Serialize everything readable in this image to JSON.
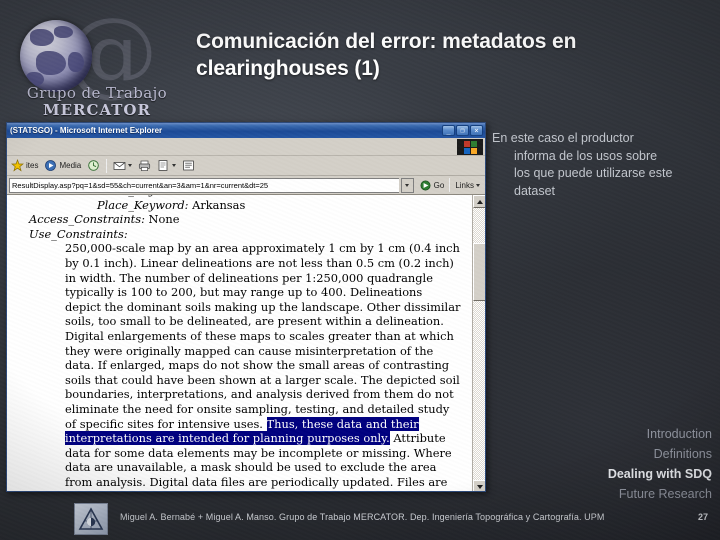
{
  "logo": {
    "at_symbol": "@",
    "line1": "Grupo de Trabajo",
    "line2": "MERCATOR"
  },
  "slide": {
    "title": "Comunicación del error: metadatos en clearinghouses (1)",
    "number": "27",
    "footer": "Miguel A. Bernabé + Miguel A. Manso. Grupo de Trabajo MERCATOR. Dep. Ingeniería Topográfica y Cartografía. UPM"
  },
  "annotation": {
    "line1": "En este caso el productor",
    "line2": "informa de los usos sobre",
    "line3": "los que puede utilizarse este",
    "line4": "dataset"
  },
  "nav": {
    "items": [
      {
        "label": "Introduction",
        "active": false
      },
      {
        "label": "Definitions",
        "active": false
      },
      {
        "label": "Dealing with SDQ",
        "active": true
      },
      {
        "label": "Future Research",
        "active": false
      }
    ]
  },
  "browser": {
    "title": "(STATSGO) - Microsoft Internet Explorer",
    "window_buttons": {
      "minimize": "_",
      "restore": "❐",
      "close": "✕"
    },
    "toolbar": {
      "favorites_label": "ites",
      "media_label": "Media",
      "history_label": "",
      "mail_label": "",
      "print_label": "",
      "edit_label": ""
    },
    "address": {
      "value": "ResultDisplay.asp?pq=1&sd=55&ch=current&an=3&am=1&nr=current&dt=25",
      "go_label": "Go",
      "links_label": "Links"
    },
    "page": {
      "line_cut": "Place_Keyword: Thesaurus: None",
      "place_keyword_label": "Place_Keyword:",
      "place_keyword_value": "Arkansas",
      "access_constraints_label": "Access_Constraints:",
      "access_constraints_value": "None",
      "use_constraints_label": "Use_Constraints:",
      "body_part1": "250,000-scale map by an area approximately 1 cm by 1 cm (0.4 inch by 0.1 inch). Linear delineations are not less than 0.5 cm (0.2 inch) in width. The number of delineations per 1:250,000 quadrangle typically is 100 to 200, but may range up to 400. Delineations depict the dominant soils making up the landscape. Other dissimilar soils, too small to be delineated, are present within a delineation. Digital enlargements of these maps to scales greater than at which they were originally mapped can cause misinterpretation of the data. If enlarged, maps do not show the small areas of contrasting soils that could have been shown at a larger scale. The depicted soil boundaries, interpretations, and analysis derived from them do not eliminate the need for onsite sampling, testing, and detailed study of specific sites for intensive uses. ",
      "highlight": "Thus, these data and their interpretations are intended for planning purposes only.",
      "body_part2": " Attribute data for some data elements may be incomplete or missing. Where data are unavailable, a mask should be used to exclude the area from analysis. Digital data files are periodically updated. Files are dated, and users are responsible for obtaining the latest version of the data."
    }
  },
  "colors": {
    "accent": "#ffffff",
    "nav_active": "#e8eaee",
    "nav_inactive": "#9195a0",
    "highlight_bg": "#000080",
    "titlebar": "#1c4a96",
    "chrome": "#d4d0c8"
  }
}
